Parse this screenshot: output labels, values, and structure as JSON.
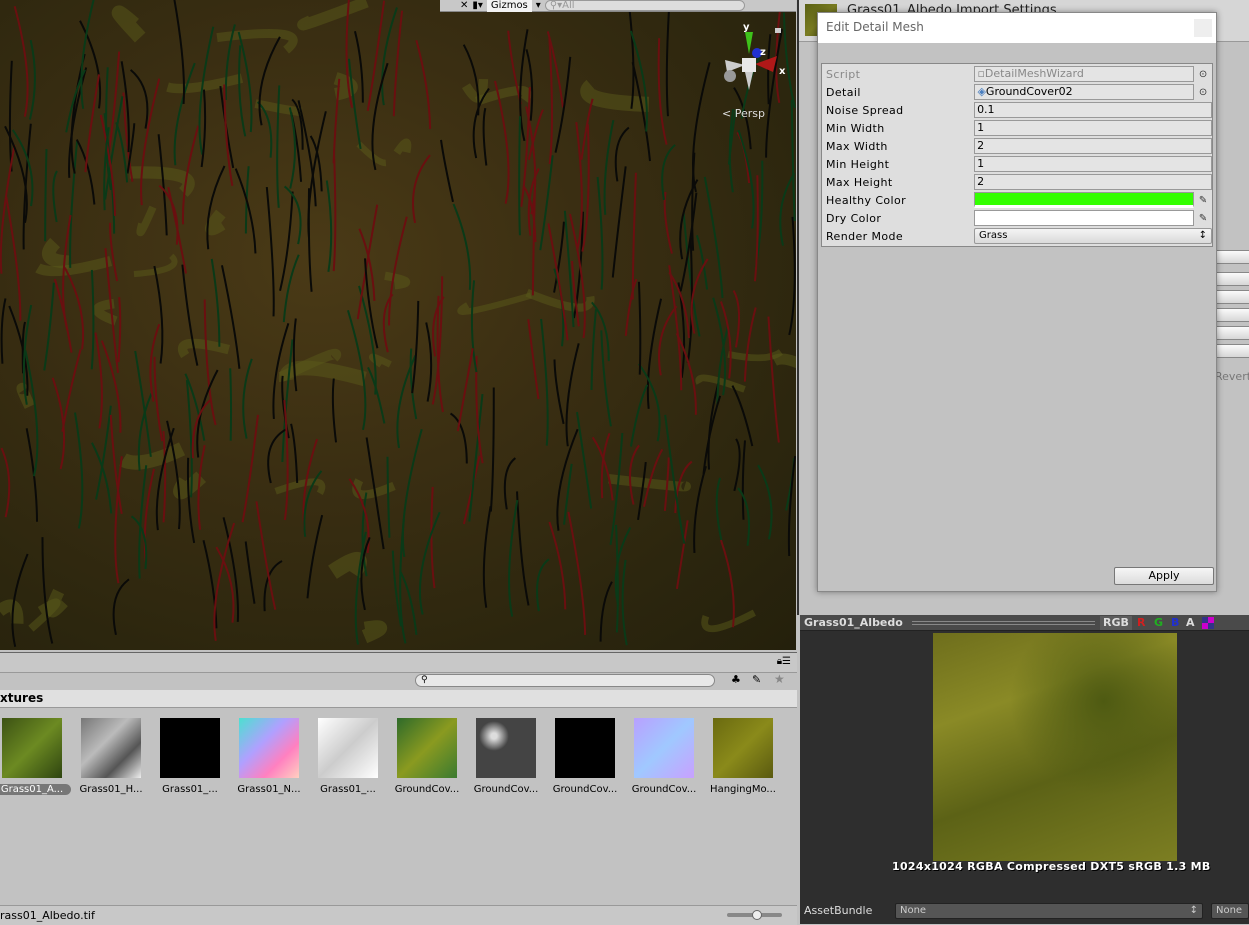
{
  "scene": {
    "toolbar": {
      "gizmos_label": "Gizmos",
      "search_placeholder": "All"
    },
    "gizmo_axes": {
      "y": "y",
      "z": "z",
      "x": "x"
    },
    "projection_label": "Persp"
  },
  "inspector": {
    "title": "Grass01_Albedo Import Settings",
    "revert_label": "Revert"
  },
  "dialog": {
    "title": "Edit Detail Mesh",
    "fields": [
      {
        "label": "Script",
        "value": "DetailMeshWizard"
      },
      {
        "label": "Detail",
        "value": "GroundCover02"
      },
      {
        "label": "Noise Spread",
        "value": "0.1"
      },
      {
        "label": "Min Width",
        "value": "1"
      },
      {
        "label": "Max Width",
        "value": "2"
      },
      {
        "label": "Min Height",
        "value": "1"
      },
      {
        "label": "Max Height",
        "value": "2"
      },
      {
        "label": "Healthy Color",
        "color": "#33ff00"
      },
      {
        "label": "Dry Color",
        "color": "#ffffff"
      },
      {
        "label": "Render Mode",
        "value": "Grass"
      }
    ],
    "apply_label": "Apply"
  },
  "preview": {
    "title": "Grass01_Albedo",
    "channels": [
      "RGB",
      "R",
      "G",
      "B",
      "A"
    ],
    "info": "1024x1024  RGBA Compressed DXT5 sRGB   1.3 MB",
    "assetbundle_label": "AssetBundle",
    "assetbundle_value": "None",
    "assetbundle_variant": "None"
  },
  "project": {
    "breadcrumb": "xtures",
    "assets": [
      {
        "name": "Grass01_A...",
        "selected": true
      },
      {
        "name": "Grass01_H..."
      },
      {
        "name": "Grass01_..."
      },
      {
        "name": "Grass01_N..."
      },
      {
        "name": "Grass01_..."
      },
      {
        "name": "GroundCov..."
      },
      {
        "name": "GroundCov..."
      },
      {
        "name": "GroundCov..."
      },
      {
        "name": "GroundCov..."
      },
      {
        "name": "HangingMo..."
      }
    ],
    "status_file": "rass01_Albedo.tif"
  }
}
